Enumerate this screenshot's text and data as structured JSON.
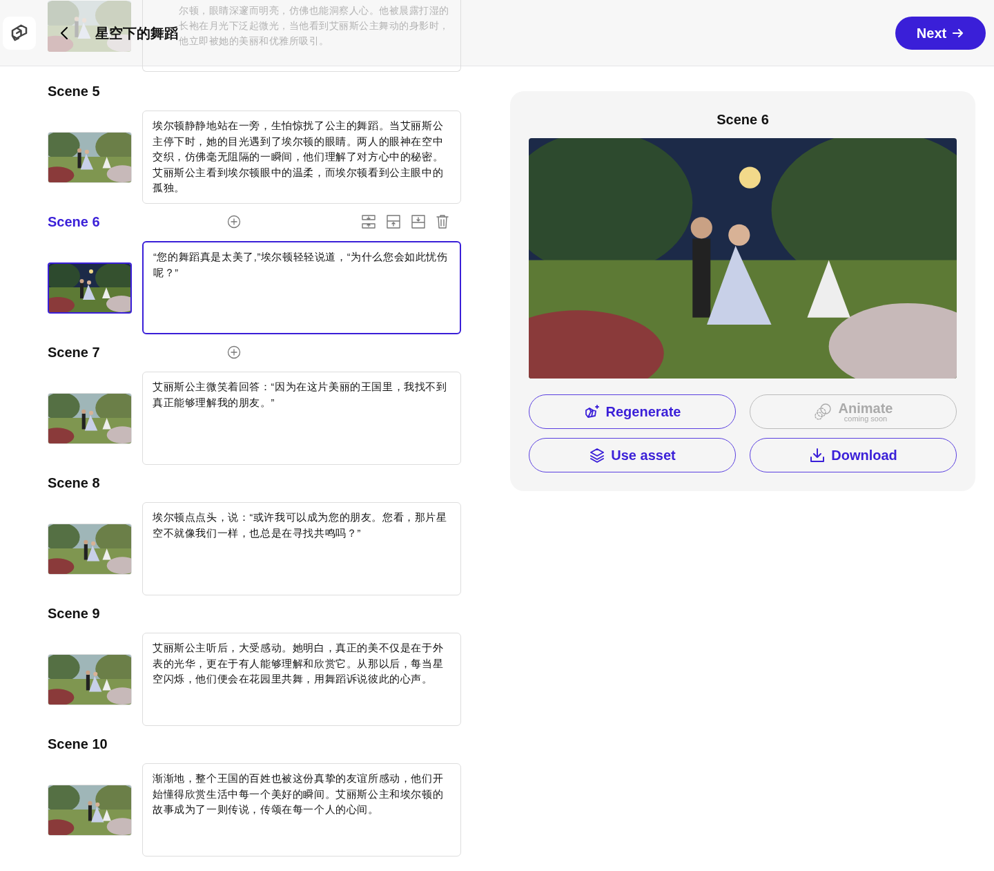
{
  "header": {
    "title": "星空下的舞蹈",
    "next_label": "Next"
  },
  "scenes": [
    {
      "kind": "partial",
      "text": "尔顿，眼睛深邃而明亮，仿佛也能洞察人心。他被晨露打湿的长袍在月光下泛起微光，当他看到艾丽斯公主舞动的身影时，他立即被她的美丽和优雅所吸引。"
    },
    {
      "kind": "full",
      "label": "Scene 5",
      "text": "埃尔顿静静地站在一旁，生怕惊扰了公主的舞蹈。当艾丽斯公主停下时，她的目光遇到了埃尔顿的眼睛。两人的眼神在空中交织，仿佛毫无阻隔的一瞬间，他们理解了对方心中的秘密。艾丽斯公主看到埃尔顿眼中的温柔，而埃尔顿看到公主眼中的孤独。",
      "selected": false
    },
    {
      "kind": "full",
      "label": "Scene 6",
      "text": "“您的舞蹈真是太美了,”埃尔顿轻轻说道，“为什么您会如此忧伤呢？”",
      "selected": true,
      "add_button": true,
      "edit_tools": true
    },
    {
      "kind": "full",
      "label": "Scene 7",
      "text": "艾丽斯公主微笑着回答：“因为在这片美丽的王国里，我找不到真正能够理解我的朋友。”",
      "selected": false,
      "add_button": true
    },
    {
      "kind": "full",
      "label": "Scene 8",
      "text": "埃尔顿点点头，说：“或许我可以成为您的朋友。您看，那片星空不就像我们一样，也总是在寻找共鸣吗？”",
      "selected": false
    },
    {
      "kind": "full",
      "label": "Scene 9",
      "text": "艾丽斯公主听后，大受感动。她明白，真正的美不仅是在于外表的光华，更在于有人能够理解和欣赏它。从那以后，每当星空闪烁，他们便会在花园里共舞，用舞蹈诉说彼此的心声。",
      "selected": false
    },
    {
      "kind": "full",
      "label": "Scene 10",
      "text": "渐渐地，整个王国的百姓也被这份真挚的友谊所感动，他们开始懂得欣赏生活中每一个美好的瞬间。艾丽斯公主和埃尔顿的故事成为了一则传说，传颂在每一个人的心间。",
      "selected": false
    }
  ],
  "preview": {
    "title": "Scene 6",
    "buttons": [
      {
        "kind": "regenerate",
        "label": "Regenerate",
        "disabled": false
      },
      {
        "kind": "animate",
        "label": "Animate",
        "sublabel": "coming soon",
        "disabled": true
      },
      {
        "kind": "use-asset",
        "label": "Use asset",
        "disabled": false
      },
      {
        "kind": "download",
        "label": "Download",
        "disabled": false
      }
    ]
  }
}
